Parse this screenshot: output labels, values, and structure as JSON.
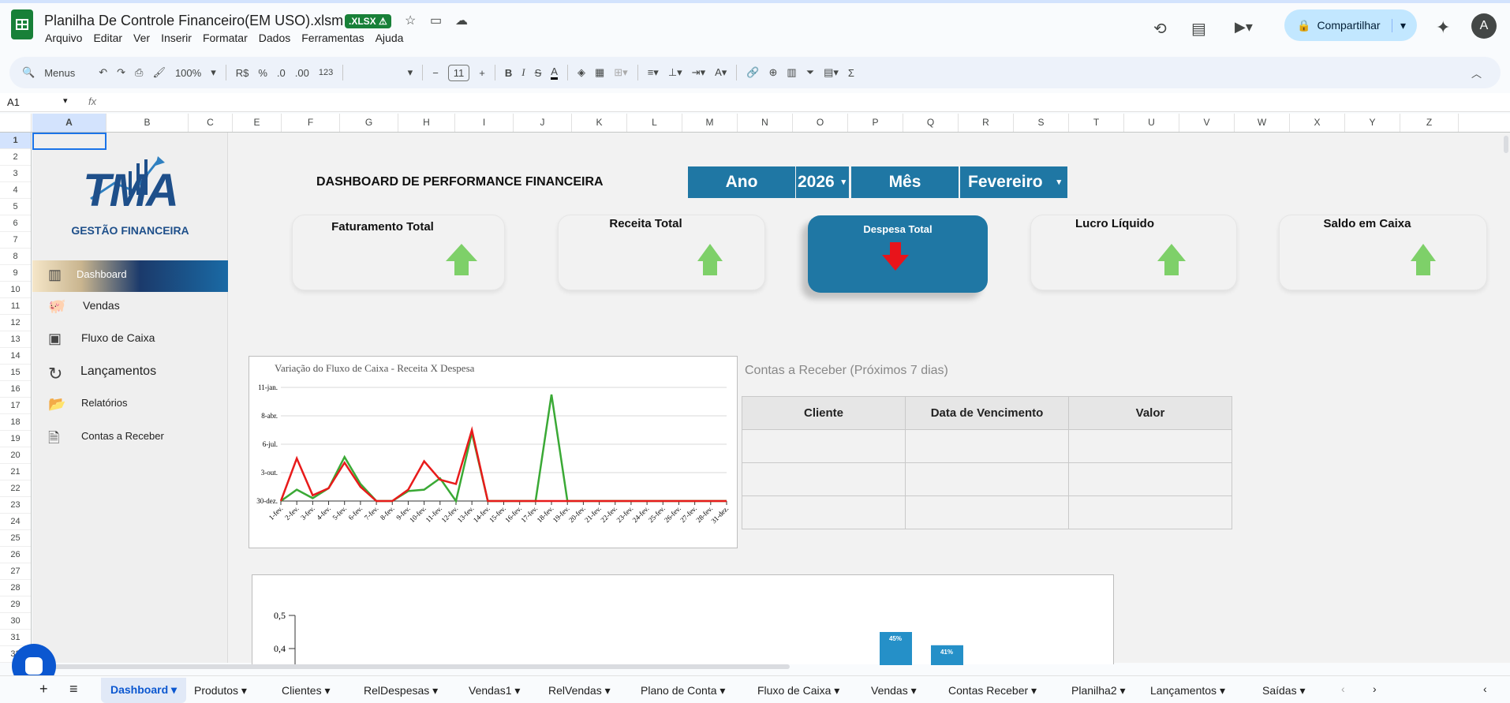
{
  "title_bar": {
    "doc_title": "Planilha De Controle Financeiro(EM USO).xlsm",
    "badge": ".XLSX ⚠",
    "share_label": "Compartilhar",
    "avatar_letter": "A"
  },
  "menu": [
    "Arquivo",
    "Editar",
    "Ver",
    "Inserir",
    "Formatar",
    "Dados",
    "Ferramentas",
    "Ajuda"
  ],
  "toolbar": {
    "search": "Menus",
    "zoom": "100%",
    "currency": "R$",
    "percent": "%",
    "dec_less": ".0",
    "dec_more": ".00",
    "format_123": "123",
    "font_size": "11"
  },
  "formula_bar": {
    "cell_ref": "A1",
    "fx": "fx"
  },
  "columns": [
    "A",
    "B",
    "C",
    "E",
    "F",
    "G",
    "H",
    "I",
    "J",
    "K",
    "L",
    "M",
    "N",
    "O",
    "P",
    "Q",
    "R",
    "S",
    "T",
    "U",
    "V",
    "W",
    "X",
    "Y",
    "Z"
  ],
  "rows": [
    "1",
    "2",
    "3",
    "4",
    "5",
    "6",
    "7",
    "8",
    "9",
    "10",
    "11",
    "12",
    "13",
    "14",
    "15",
    "16",
    "17",
    "18",
    "19",
    "20",
    "21",
    "22",
    "23",
    "24",
    "25",
    "26",
    "27",
    "28",
    "29",
    "30",
    "31",
    "32"
  ],
  "brand": {
    "logo_text": "TMA",
    "subtitle": "GESTÃO FINANCEIRA"
  },
  "nav": [
    {
      "label": "Dashboard",
      "icon": "bar-chart-icon"
    },
    {
      "label": "Vendas",
      "icon": "piggy-bank-icon"
    },
    {
      "label": "Fluxo de Caixa",
      "icon": "cash-register-icon"
    },
    {
      "label": "Lançamentos",
      "icon": "refresh-icon"
    },
    {
      "label": "Relatórios",
      "icon": "folder-icon"
    },
    {
      "label": "Contas a Receber",
      "icon": "document-icon"
    }
  ],
  "dashboard": {
    "title": "DASHBOARD DE PERFORMANCE FINANCEIRA",
    "ano_label": "Ano",
    "ano_value": "2026",
    "mes_label": "Mês",
    "mes_value": "Fevereiro"
  },
  "kpis": [
    {
      "title": "Faturamento Total",
      "trend": "up"
    },
    {
      "title": "Receita Total",
      "trend": "up"
    },
    {
      "title": "Despesa Total",
      "trend": "down"
    },
    {
      "title": "Lucro Líquido",
      "trend": "up"
    },
    {
      "title": "Saldo em Caixa",
      "trend": "up"
    }
  ],
  "colors": {
    "accent_blue": "#1f77a4",
    "up_green": "#7ed069",
    "down_red": "#e8141b",
    "series_green": "#3aa935",
    "series_red": "#e81b1b"
  },
  "receivables": {
    "title": "Contas a Receber (Próximos 7 dias)",
    "headers": [
      "Cliente",
      "Data de Vencimento",
      "Valor"
    ]
  },
  "chart_data": [
    {
      "type": "line",
      "title": "Variação do Fluxo de Caixa - Receita X Despesa",
      "y_tick_labels": [
        "30-dez.",
        "3-out.",
        "6-jul.",
        "8-abr.",
        "11-jan."
      ],
      "categories": [
        "1-fev.",
        "2-fev.",
        "3-fev.",
        "4-fev.",
        "5-fev.",
        "6-fev.",
        "7-fev.",
        "8-fev.",
        "9-fev.",
        "10-fev.",
        "11-fev.",
        "12-fev.",
        "13-fev.",
        "14-fev.",
        "15-fev.",
        "16-fev.",
        "17-fev.",
        "18-fev.",
        "19-fev.",
        "20-fev.",
        "21-fev.",
        "22-fev.",
        "23-fev.",
        "24-fev.",
        "25-fev.",
        "26-fev.",
        "27-fev.",
        "28-fev.",
        "31-dez."
      ],
      "ylim": [
        0,
        4
      ],
      "series": [
        {
          "values": [
            0,
            0.4,
            0.1,
            0.45,
            1.55,
            0.6,
            0,
            0,
            0.35,
            0.4,
            0.8,
            0,
            2.4,
            0,
            0,
            0,
            0,
            3.75,
            0,
            0,
            0,
            0,
            0,
            0,
            0,
            0,
            0,
            0,
            0
          ]
        },
        {
          "values": [
            0,
            1.5,
            0.2,
            0.45,
            1.35,
            0.5,
            0,
            0,
            0.4,
            1.4,
            0.75,
            0.6,
            2.5,
            0,
            0,
            0,
            0,
            0,
            0,
            0,
            0,
            0,
            0,
            0,
            0,
            0,
            0,
            0,
            0
          ]
        }
      ]
    },
    {
      "type": "bar",
      "y_tick_labels": [
        "0,5",
        "0,4"
      ],
      "ylim": [
        0,
        0.5
      ],
      "values": [
        0.45,
        0.41
      ],
      "data_labels": [
        "45%",
        "41%"
      ]
    }
  ],
  "sheet_tabs": [
    "Dashboard",
    "Produtos",
    "Clientes",
    "RelDespesas",
    "Vendas1",
    "RelVendas",
    "Plano de Conta",
    "Fluxo de Caixa",
    "Vendas",
    "Contas Receber",
    "Planilha2",
    "Lançamentos",
    "Saídas"
  ]
}
